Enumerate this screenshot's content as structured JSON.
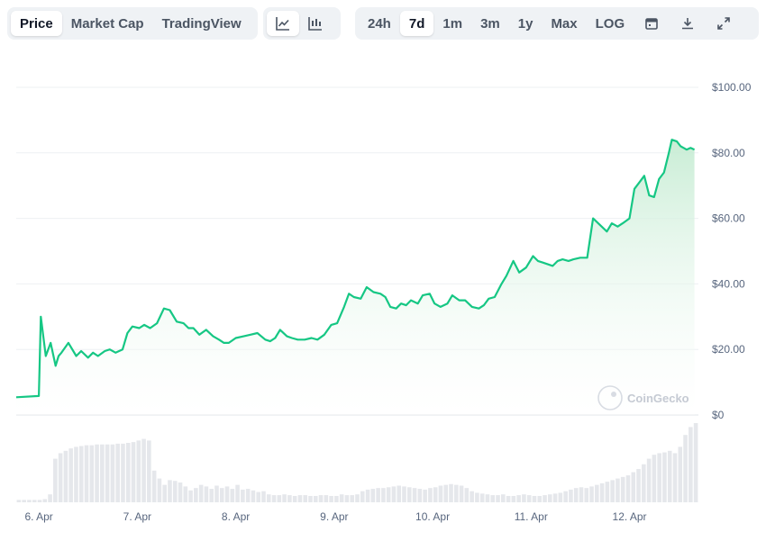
{
  "toolbar": {
    "view_tabs": [
      "Price",
      "Market Cap",
      "TradingView"
    ],
    "active_view": "Price",
    "chart_type_icons": [
      "line-chart-icon",
      "candlestick-chart-icon"
    ],
    "ranges": [
      "24h",
      "7d",
      "1m",
      "3m",
      "1y",
      "Max",
      "LOG"
    ],
    "active_range": "7d",
    "action_icons": [
      "calendar-icon",
      "download-icon",
      "expand-icon"
    ]
  },
  "watermark": "CoinGecko",
  "colors": {
    "line": "#16c784",
    "area_top": "#c6ecd3",
    "volume": "#e5e7eb",
    "grid": "#eef0f3"
  },
  "chart_data": {
    "type": "area",
    "ylim": [
      0,
      100
    ],
    "yticks": [
      0,
      20,
      40,
      60,
      80,
      100
    ],
    "ytick_labels": [
      "$0",
      "$20.00",
      "$40.00",
      "$60.00",
      "$80.00",
      "$100.00"
    ],
    "xlim": [
      5.77,
      12.7
    ],
    "xticks": [
      6,
      7,
      8,
      9,
      10,
      11,
      12
    ],
    "xtick_labels": [
      "6. Apr",
      "7. Apr",
      "8. Apr",
      "9. Apr",
      "10. Apr",
      "11. Apr",
      "12. Apr"
    ],
    "price_series": {
      "x": [
        5.77,
        6.0,
        6.02,
        6.07,
        6.12,
        6.17,
        6.2,
        6.23,
        6.3,
        6.38,
        6.43,
        6.5,
        6.55,
        6.6,
        6.67,
        6.72,
        6.78,
        6.85,
        6.9,
        6.95,
        7.02,
        7.07,
        7.13,
        7.2,
        7.27,
        7.33,
        7.4,
        7.47,
        7.52,
        7.57,
        7.63,
        7.7,
        7.77,
        7.83,
        7.88,
        7.93,
        8.0,
        8.08,
        8.15,
        8.22,
        8.3,
        8.35,
        8.4,
        8.45,
        8.52,
        8.57,
        8.63,
        8.7,
        8.77,
        8.83,
        8.9,
        8.97,
        9.03,
        9.1,
        9.15,
        9.2,
        9.27,
        9.33,
        9.4,
        9.47,
        9.52,
        9.57,
        9.63,
        9.68,
        9.73,
        9.78,
        9.85,
        9.9,
        9.97,
        10.02,
        10.08,
        10.15,
        10.2,
        10.27,
        10.33,
        10.4,
        10.47,
        10.52,
        10.57,
        10.63,
        10.7,
        10.75,
        10.82,
        10.88,
        10.95,
        11.02,
        11.07,
        11.12,
        11.17,
        11.22,
        11.27,
        11.32,
        11.38,
        11.43,
        11.5,
        11.57,
        11.63,
        11.7,
        11.77,
        11.82,
        11.88,
        11.93,
        12.0,
        12.05,
        12.1,
        12.15,
        12.2,
        12.25,
        12.3,
        12.35,
        12.4,
        12.43,
        12.48,
        12.52,
        12.55,
        12.58,
        12.62,
        12.66
      ],
      "y": [
        5.4,
        5.8,
        30.0,
        18.0,
        22.0,
        15.0,
        18.0,
        19.0,
        22.0,
        18.0,
        19.5,
        17.5,
        19.0,
        18.0,
        19.5,
        20.0,
        19.0,
        20.0,
        25.0,
        27.0,
        26.5,
        27.5,
        26.5,
        28.0,
        32.5,
        32.0,
        28.5,
        28.0,
        26.5,
        26.5,
        24.5,
        26.0,
        24.0,
        23.0,
        22.0,
        22.0,
        23.5,
        24.0,
        24.5,
        25.0,
        23.0,
        22.5,
        23.5,
        26.0,
        24.0,
        23.5,
        23.0,
        23.0,
        23.5,
        23.0,
        24.5,
        27.5,
        28.0,
        33.0,
        37.0,
        36.0,
        35.5,
        39.0,
        37.5,
        37.0,
        36.0,
        33.0,
        32.5,
        34.0,
        33.5,
        35.0,
        34.0,
        36.5,
        37.0,
        34.0,
        33.0,
        34.0,
        36.5,
        35.0,
        35.0,
        33.0,
        32.5,
        33.5,
        35.5,
        36.0,
        40.0,
        42.5,
        47.0,
        43.5,
        45.0,
        48.5,
        47.0,
        46.5,
        46.0,
        45.5,
        47.0,
        47.5,
        47.0,
        47.5,
        48.0,
        48.0,
        60.0,
        58.0,
        56.0,
        58.5,
        57.5,
        58.5,
        60.0,
        69.0,
        71.0,
        73.0,
        67.0,
        66.5,
        72.0,
        74.0,
        80.0,
        84.0,
        83.5,
        82.0,
        81.5,
        81.0,
        81.5,
        81.0
      ]
    },
    "volume_series": {
      "description": "",
      "values": [
        3,
        3,
        3,
        3,
        3,
        4,
        10,
        55,
        62,
        65,
        68,
        70,
        71,
        72,
        72,
        73,
        73,
        73,
        73,
        74,
        74,
        75,
        76,
        78,
        80,
        78,
        40,
        30,
        22,
        28,
        27,
        25,
        20,
        15,
        18,
        22,
        20,
        17,
        21,
        18,
        20,
        17,
        22,
        16,
        17,
        15,
        13,
        14,
        10,
        9,
        9,
        10,
        9,
        8,
        9,
        9,
        8,
        8,
        9,
        9,
        8,
        8,
        10,
        9,
        9,
        10,
        14,
        16,
        17,
        18,
        18,
        19,
        20,
        21,
        20,
        19,
        18,
        17,
        16,
        18,
        19,
        21,
        22,
        23,
        22,
        21,
        18,
        14,
        12,
        11,
        10,
        9,
        9,
        10,
        8,
        8,
        9,
        10,
        9,
        8,
        8,
        9,
        10,
        11,
        12,
        14,
        16,
        18,
        19,
        18,
        20,
        22,
        24,
        26,
        28,
        30,
        32,
        34,
        38,
        42,
        48,
        55,
        60,
        62,
        63,
        65,
        62,
        70,
        85,
        95,
        100
      ]
    }
  }
}
